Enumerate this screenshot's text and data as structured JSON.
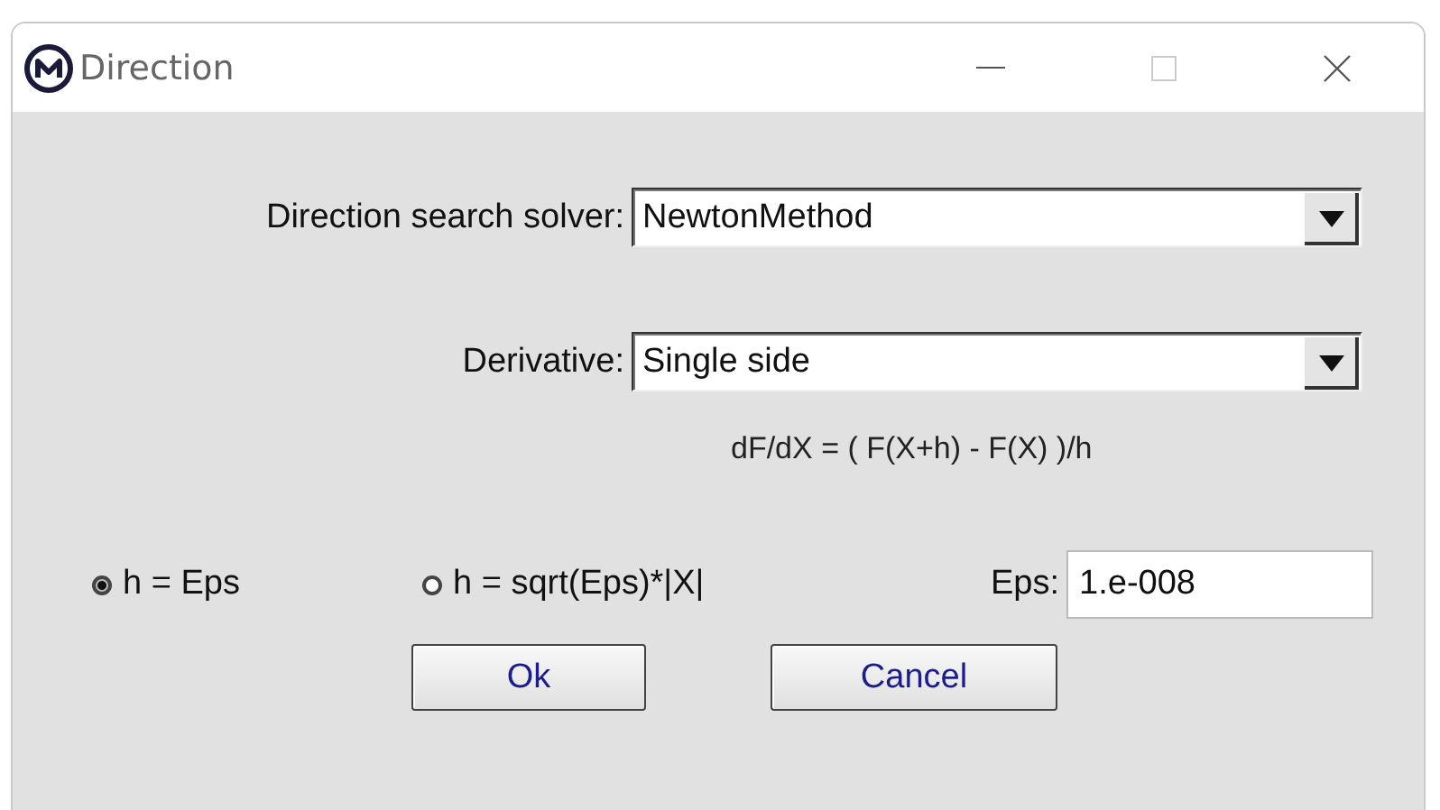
{
  "window": {
    "title": "Direction"
  },
  "solver": {
    "label": "Direction search solver:",
    "value": "NewtonMethod"
  },
  "derivative": {
    "label": "Derivative:",
    "value": "Single side"
  },
  "formula": "dF/dX = ( F(X+h) - F(X) )/h",
  "step_options": [
    {
      "label": "h = Eps",
      "selected": true
    },
    {
      "label": "h = sqrt(Eps)*|X|",
      "selected": false
    }
  ],
  "eps": {
    "label": "Eps:",
    "value": "1.e-008"
  },
  "buttons": [
    "Ok",
    "Cancel"
  ]
}
